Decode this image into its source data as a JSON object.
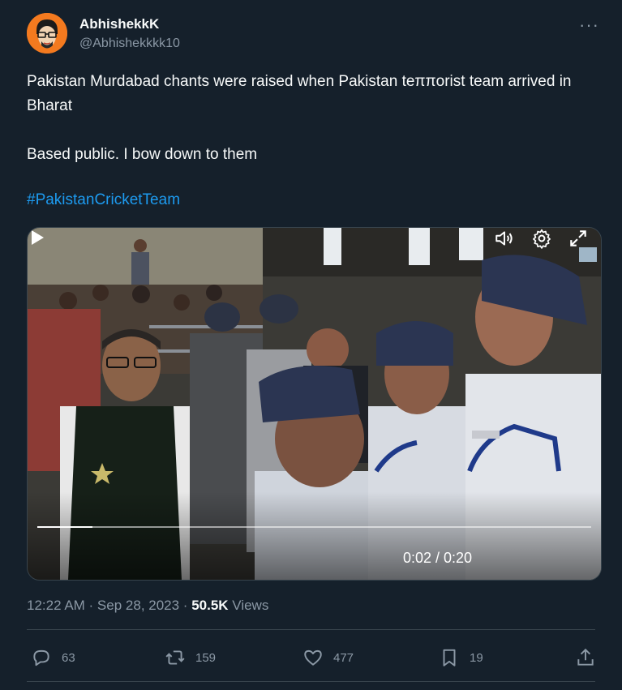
{
  "author": {
    "name": "AbhishekkK",
    "handle": "@Abhishekkkk10"
  },
  "more_label": "···",
  "tweet": {
    "line1": "Pakistan Murdabad chants were raised when Pakistan teππorist team arrived in Bharat",
    "line2": "Based public. I bow down to them",
    "hashtag": "#PakistanCricketTeam"
  },
  "video": {
    "time": "0:02 / 0:20",
    "progress": 0.1
  },
  "meta": {
    "timestamp": "12:22 AM · Sep 28, 2023 · ",
    "views_count": "50.5K",
    "views_label": " Views"
  },
  "actions": {
    "replies": "63",
    "retweets": "159",
    "likes": "477",
    "bookmarks": "19"
  },
  "colors": {
    "background": "#15202b",
    "accent": "#1d9bf0",
    "secondary_text": "#8b98a5"
  }
}
